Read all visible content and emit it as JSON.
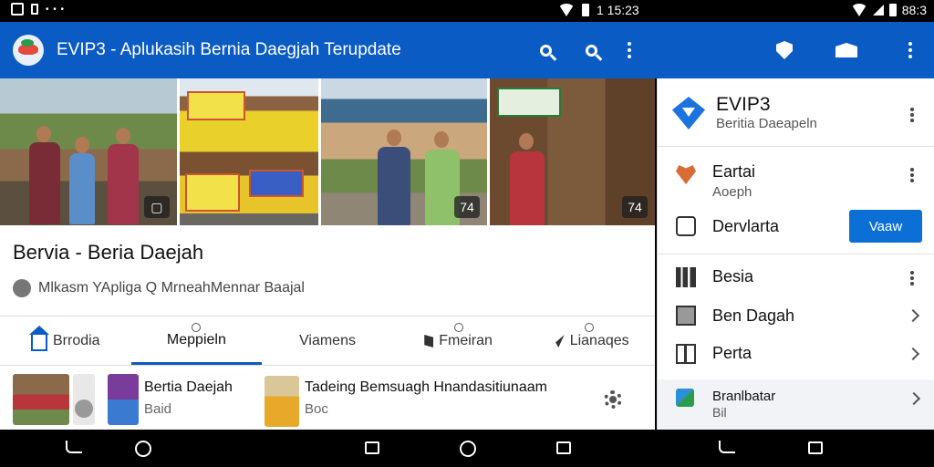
{
  "status_bar": {
    "time_left": "1 15:23",
    "time_right": "88:3"
  },
  "app_bar": {
    "title": "EVIP3 - Aplukasih Bernia Daegjah Terupdate"
  },
  "photos": {
    "badges": [
      "",
      "74",
      "74"
    ]
  },
  "article": {
    "headline": "Bervia - Beria Daejah",
    "meta": "Mlkasm YApliga  Q  MrneahMennar Baajal"
  },
  "tabs": [
    {
      "label": "Brrodia",
      "active": false
    },
    {
      "label": "Meppieln",
      "active": true
    },
    {
      "label": "Viamens",
      "active": false
    },
    {
      "label": "Fmeiran",
      "active": false
    },
    {
      "label": "Lianaqes",
      "active": false
    }
  ],
  "strip": {
    "item1": {
      "title": "Bertia Daejah",
      "sub": "Baid"
    },
    "item2": {
      "title": "Tadeing Bemsuagh Hnandasitiunaam",
      "sub": "Boc"
    }
  },
  "right_panel": {
    "header": {
      "title": "EVIP3",
      "subtitle": "Beritia Daeapeln"
    },
    "rows": [
      {
        "label": "Eartai",
        "sub": "Aoeph"
      },
      {
        "label": "Dervlarta",
        "button": "Vaaw"
      },
      {
        "label": "Besia"
      },
      {
        "label": "Ben Dagah"
      },
      {
        "label": "Perta"
      },
      {
        "label": "Branlbatar",
        "sub": "Bil"
      }
    ]
  },
  "colors": {
    "app_bar": "#0b5bc4",
    "accent": "#0b6fd6"
  }
}
